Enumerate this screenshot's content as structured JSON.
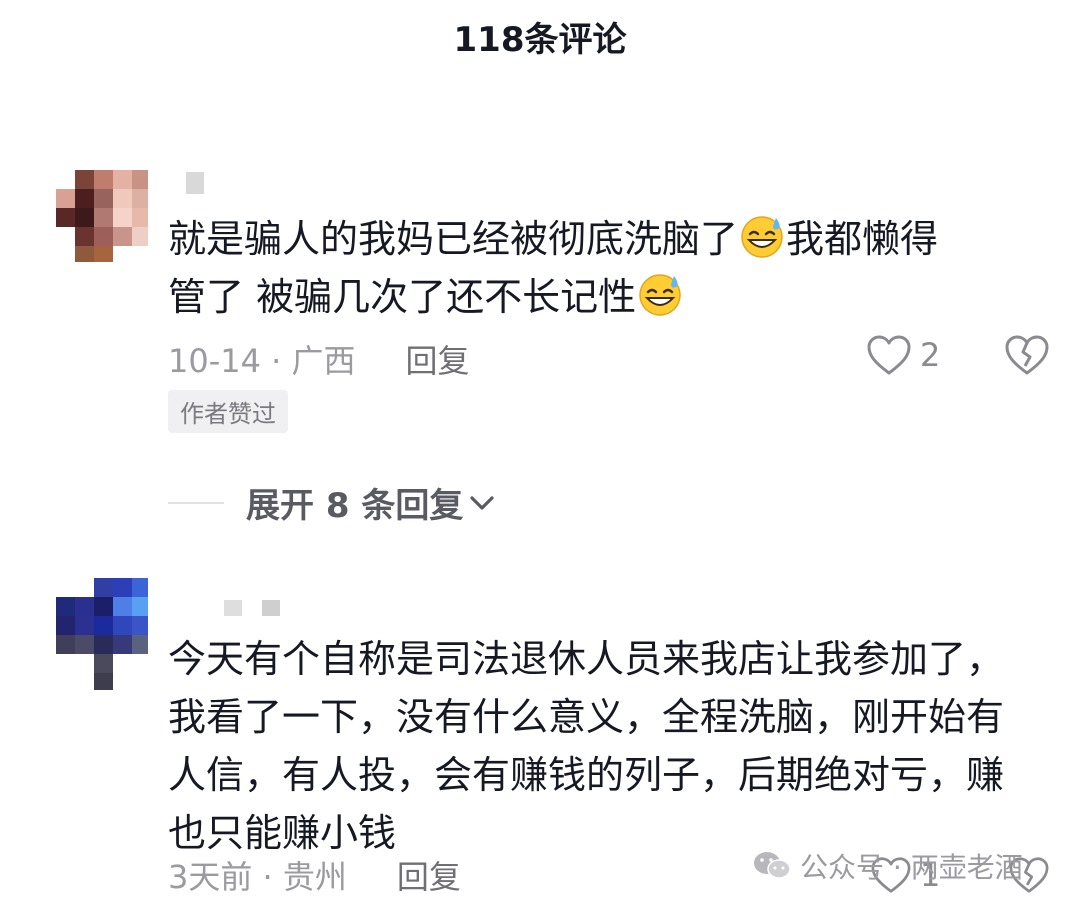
{
  "header": {
    "title": "118条评论"
  },
  "comments": [
    {
      "text_line1": "就是骗人的我妈已经被彻底洗脑了",
      "text_mid": "我都懒得",
      "text_line2": "管了 被骗几次了还不长记性",
      "emoji_icon": "grinning-sweat-emoji",
      "date_location": "10-14 · 广西",
      "reply_label": "回复",
      "like_count": "2",
      "author_badge": "作者赞过"
    },
    {
      "text": "今天有个自称是司法退休人员来我店让我参加了，我看了一下，没有什么意义，全程洗脑，刚开始有人信，有人投，会有赚钱的列子，后期绝对亏，赚也只能赚小钱",
      "date_location": "3天前 · 贵州",
      "reply_label": "回复",
      "like_count": "1"
    }
  ],
  "expand_replies": {
    "label": "展开 8 条回复"
  },
  "watermark": {
    "text": "公众号 · 两壶老酒"
  },
  "colors": {
    "text": "#161823",
    "meta": "#9a9aa0",
    "accent": "#ffcc33"
  }
}
